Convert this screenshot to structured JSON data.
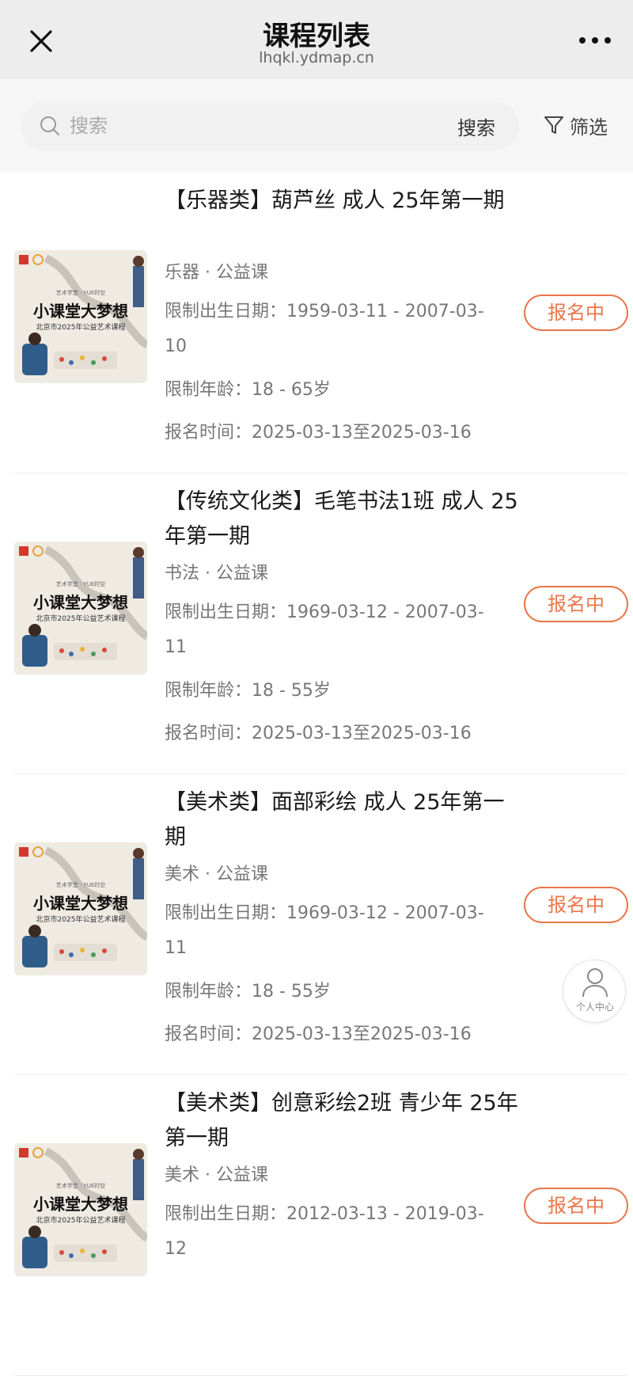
{
  "nav": {
    "title": "课程列表",
    "url": "lhqkl.ydmap.cn",
    "close_icon": "close-icon",
    "more_icon": "more-icon"
  },
  "search": {
    "placeholder": "搜索",
    "button_label": "搜索",
    "filter_label": "筛选"
  },
  "thumbnail_text": {
    "top": "艺术学堂 · YUE时空",
    "main": "小课堂大梦想",
    "sub": "北京市2025年公益艺术课程"
  },
  "courses": [
    {
      "title": "【乐器类】葫芦丝 成人 25年第一期",
      "category": "乐器 · 公益课",
      "birth_range": "限制出生日期：1959-03-11 - 2007-03-10",
      "age_range": "限制年龄：18 - 65岁",
      "signup_time": "报名时间：2025-03-13至2025-03-16",
      "status": "报名中"
    },
    {
      "title": "【传统文化类】毛笔书法1班 成人 25年第一期",
      "category": "书法 · 公益课",
      "birth_range": "限制出生日期：1969-03-12 - 2007-03-11",
      "age_range": "限制年龄：18 - 55岁",
      "signup_time": "报名时间：2025-03-13至2025-03-16",
      "status": "报名中"
    },
    {
      "title": "【美术类】面部彩绘 成人 25年第一期",
      "category": "美术 · 公益课",
      "birth_range": "限制出生日期：1969-03-12 - 2007-03-11",
      "age_range": "限制年龄：18 - 55岁",
      "signup_time": "报名时间：2025-03-13至2025-03-16",
      "status": "报名中"
    },
    {
      "title": "【美术类】创意彩绘2班 青少年 25年第一期",
      "category": "美术 · 公益课",
      "birth_range": "限制出生日期：2012-03-13 - 2019-03-12",
      "status": "报名中"
    }
  ],
  "personal_center": {
    "label": "个人中心",
    "icon": "user-icon"
  },
  "colors": {
    "accent": "#e8764a",
    "nav_bg": "#ededed",
    "search_bg": "#f6f6f6"
  }
}
